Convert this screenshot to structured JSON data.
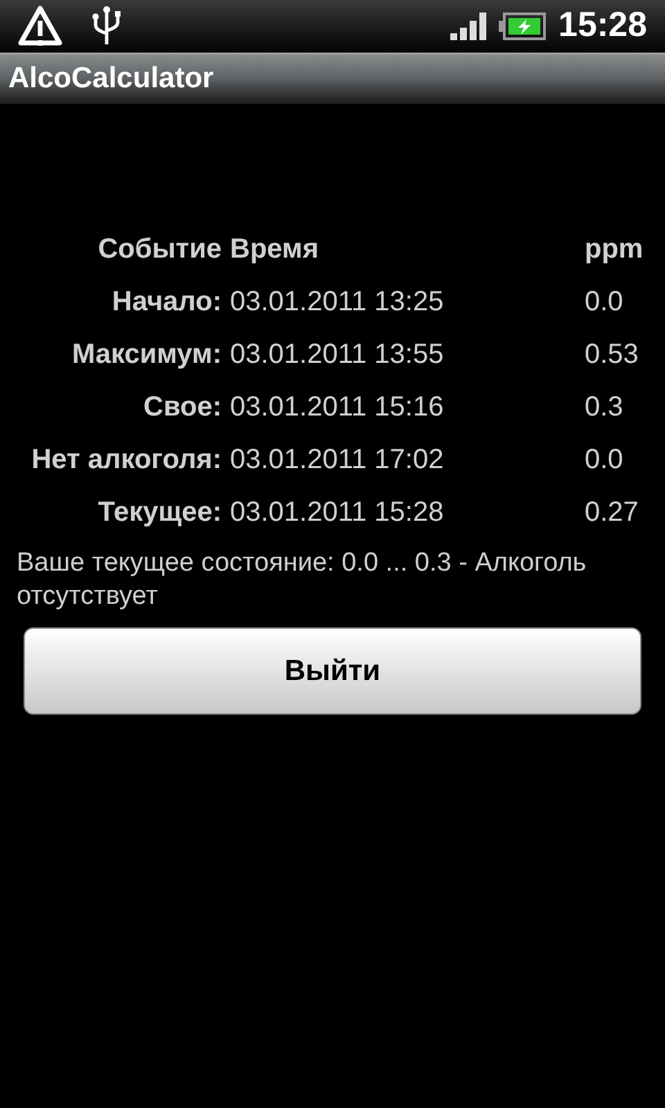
{
  "status_bar": {
    "time": "15:28"
  },
  "window": {
    "title": "AlcoCalculator"
  },
  "table": {
    "columns": [
      "Событие",
      "Время",
      "ppm"
    ],
    "rows": [
      {
        "event": "Начало:",
        "time": "03.01.2011 13:25",
        "ppm": "0.0"
      },
      {
        "event": "Максимум:",
        "time": "03.01.2011 13:55",
        "ppm": "0.53"
      },
      {
        "event": "Свое:",
        "time": "03.01.2011 15:16",
        "ppm": "0.3"
      },
      {
        "event": "Нет алкоголя:",
        "time": "03.01.2011 17:02",
        "ppm": "0.0"
      },
      {
        "event": "Текущее:",
        "time": "03.01.2011 15:28",
        "ppm": "0.27"
      }
    ]
  },
  "status_text": "Ваше текущее состояние: 0.0 ... 0.3 - Алкоголь отсутствует",
  "buttons": [
    "Выйти"
  ]
}
